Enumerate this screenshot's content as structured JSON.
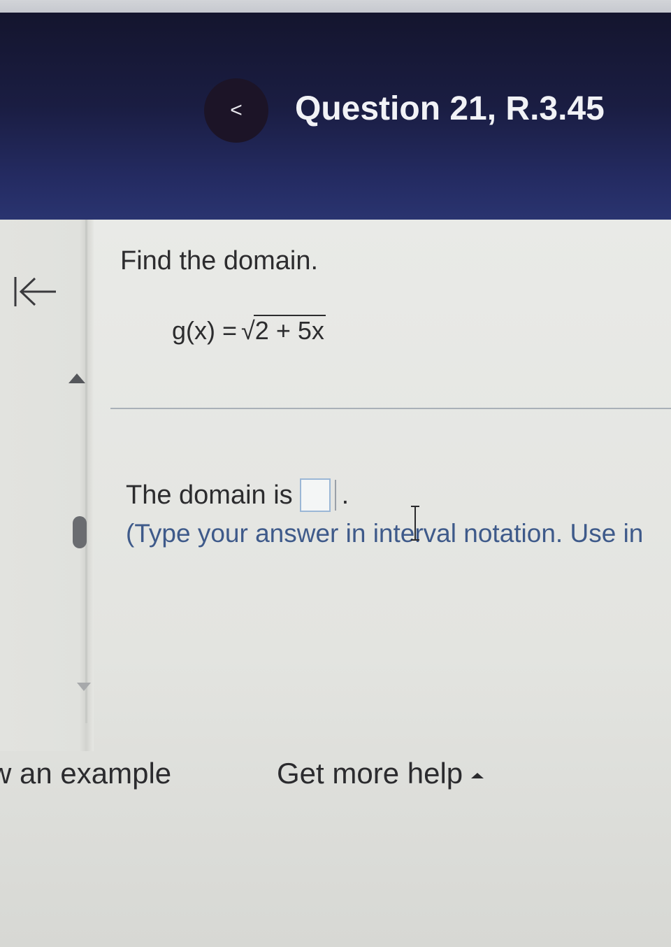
{
  "header": {
    "back_glyph": "<",
    "title": "Question 21, R.3.45"
  },
  "sidebar": {
    "collapse_icon": "collapse-left-icon"
  },
  "question": {
    "prompt": "Find the domain.",
    "function_lhs": "g(x) =",
    "radical_glyph": "√",
    "radicand": "2 + 5x"
  },
  "answer": {
    "label": "The domain is",
    "value": "",
    "trailing": ".",
    "hint": "(Type your answer in interval notation. Use in"
  },
  "footer": {
    "example_label": "w an example",
    "help_label": "Get more help"
  },
  "colors": {
    "header_bg": "#1a1d42",
    "hint_text": "#3e5a8a",
    "answer_box_border": "#9bb7d6"
  }
}
